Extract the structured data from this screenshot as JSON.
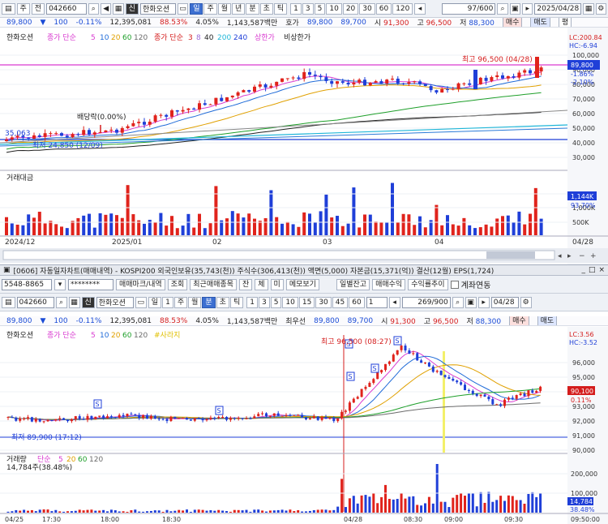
{
  "top": {
    "toolbar": {
      "market": "주",
      "type": "전",
      "code": "042660",
      "name": "한화오션",
      "hanja": "신",
      "periods": [
        "일",
        "주",
        "월",
        "년",
        "분",
        "초",
        "틱"
      ],
      "active_period": "일",
      "nums": [
        "1",
        "3",
        "5",
        "10",
        "20",
        "30",
        "60",
        "120"
      ],
      "count": "97/600",
      "date": "2025/04/28"
    },
    "quote": {
      "price": "89,800",
      "change": "▼",
      "chg_amt": "100",
      "chg_pct": "-0.11%",
      "volume": "12,395,081",
      "ratio": "88.53%",
      "turnover_pct": "4.05%",
      "amount": "1,143,587백만",
      "label_hoga": "호가",
      "bid": "89,800",
      "ask": "89,700",
      "open_label": "시",
      "open": "91,300",
      "high_label": "고",
      "high": "96,500",
      "low_label": "저",
      "low": "88,300",
      "buy_btn": "매수",
      "sell_btn": "매도",
      "eval": "평"
    },
    "legend": {
      "name": "한화오션",
      "ma_label": "종가 단순",
      "ma": [
        "5",
        "10",
        "20",
        "60",
        "120"
      ],
      "ma2_label": "종가 단순",
      "ma2": [
        "3",
        "8",
        "40",
        "200",
        "240"
      ],
      "upper": "상한가",
      "lower": "비상한가"
    },
    "price_axis": {
      "ticks": [
        "100,000",
        "90,000",
        "80,000",
        "70,000",
        "60,000",
        "50,000",
        "40,000",
        "30,000"
      ],
      "lc": "LC:200.84",
      "hc": "HC:-6.94",
      "current": "89,800",
      "cur_pct": "-1.86%",
      "lo_pct": "-2.10%"
    },
    "annotations": {
      "high": "최고 96,500 (04/28)",
      "dividend": "배당락(0.00%)",
      "left_value": "35,063",
      "low_label": "최저 24,850 (12/09)"
    },
    "volume": {
      "label": "거래대금",
      "ticks": [
        "1,500K",
        "1,000K",
        "500K"
      ],
      "current": "1,144K",
      "cur_pct": "93.70%"
    },
    "dates": [
      "2024/12",
      "2025/01",
      "02",
      "03",
      "04",
      "04/28"
    ]
  },
  "window": {
    "title": "[0606] 자동일자차트(매매내역) - KOSPI200 외국인보유(35,743(천)) 주식수(306,413(천)) 액면(5,000) 자본금(15,371(억)) 결산(12월) EPS(1,724)",
    "account": "5548-8865",
    "password": "********",
    "btns": [
      "매매마크/내역",
      "조회",
      "최근매매종목",
      "잔",
      "체",
      "미",
      "메모보기",
      "일별잔고",
      "매매수익",
      "수익률추이"
    ],
    "checkbox": "계좌연동"
  },
  "bottom": {
    "toolbar": {
      "code": "042660",
      "name": "한화오션",
      "hanja": "신",
      "periods": [
        "일",
        "1",
        "주",
        "월",
        "분",
        "초",
        "틱"
      ],
      "active_period": "분",
      "nums": [
        "1",
        "3",
        "5",
        "10",
        "15",
        "30",
        "45",
        "60"
      ],
      "sel": "1",
      "count": "269/900",
      "date": "04/28"
    },
    "quote": {
      "price": "89,800",
      "change": "▼",
      "chg_amt": "100",
      "chg_pct": "-0.11%",
      "volume": "12,395,081",
      "ratio": "88.53%",
      "turnover_pct": "4.05%",
      "amount": "1,143,587백만",
      "label_hoga": "최우선",
      "bid": "89,800",
      "ask": "89,700",
      "open_label": "시",
      "open": "91,300",
      "high_label": "고",
      "high": "96,500",
      "low_label": "저",
      "low": "88,300",
      "buy_btn": "매수",
      "sell_btn": "매도"
    },
    "legend": {
      "name": "한화오션",
      "ma_label": "종가 단순",
      "ma": [
        "5",
        "10",
        "20",
        "60",
        "120"
      ],
      "extra": "#사라지"
    },
    "price_axis": {
      "ticks": [
        "96,000",
        "95,000",
        "94,000",
        "93,000",
        "92,000",
        "91,000",
        "90,000"
      ],
      "lc": "LC:3.56",
      "hc": "HC:-3.52",
      "current": "90,100",
      "cur_pct": "0.11%"
    },
    "annotations": {
      "high": "최고 96,500 (08:27)",
      "low_label": "최저 89,900 (17:12)",
      "marker": "S"
    },
    "volume": {
      "label": "거래량",
      "ma_label": "단순",
      "ma": [
        "5",
        "20",
        "60",
        "120"
      ],
      "value": "14,784주(38.48%)",
      "ticks": [
        "200,000",
        "100,000"
      ],
      "current": "14,784",
      "cur_pct": "38.48%"
    },
    "dates": [
      "04/25",
      "17:30",
      "18:00",
      "18:30",
      "04/28",
      "08:30",
      "09:00",
      "09:30",
      "09:50:00"
    ]
  },
  "colors": {
    "up": "#e0231c",
    "down": "#1f3fd8",
    "accent": "#3c6fd1",
    "ma5": "#d93bd0",
    "ma10": "#1f6bd8",
    "ma20": "#e0a000",
    "ma60": "#1e9f2a",
    "ma120": "#6b6b6b"
  }
}
